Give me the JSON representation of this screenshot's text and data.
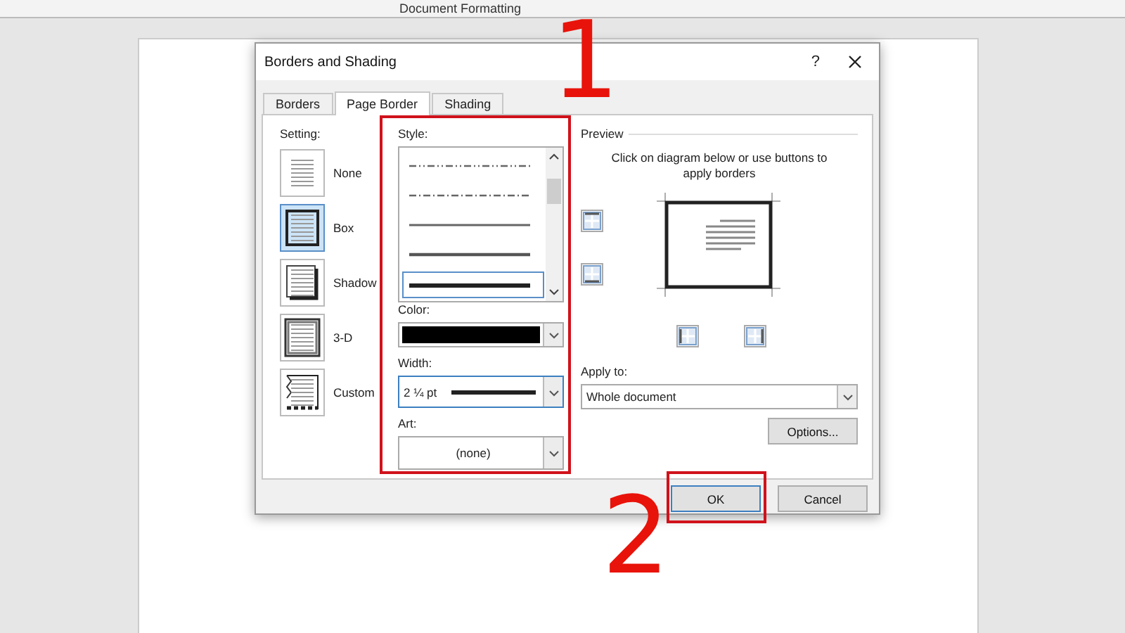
{
  "app_title": "Document Formatting",
  "dialog": {
    "title": "Borders and Shading",
    "help": "?",
    "tabs": [
      {
        "label": "Borders",
        "selected": false
      },
      {
        "label": "Page Border",
        "selected": true
      },
      {
        "label": "Shading",
        "selected": false
      }
    ],
    "setting": {
      "label": "Setting:",
      "options": [
        {
          "kind": "none",
          "label": "None",
          "selected": false
        },
        {
          "kind": "box",
          "label": "Box",
          "selected": true
        },
        {
          "kind": "shadow",
          "label": "Shadow",
          "selected": false
        },
        {
          "kind": "threed",
          "label": "3-D",
          "selected": false
        },
        {
          "kind": "custom",
          "label": "Custom",
          "selected": false
        }
      ]
    },
    "style": {
      "label": "Style:",
      "options": [
        {
          "kind": "dash-dot-dot",
          "selected": false
        },
        {
          "kind": "dash-dot",
          "selected": false
        },
        {
          "kind": "thin",
          "selected": false
        },
        {
          "kind": "medium",
          "selected": false
        },
        {
          "kind": "thick",
          "selected": true
        }
      ]
    },
    "color": {
      "label": "Color:",
      "color": "#000000"
    },
    "width": {
      "label": "Width:",
      "value": "2 ¼ pt"
    },
    "art": {
      "label": "Art:",
      "value": "(none)"
    },
    "preview": {
      "label": "Preview",
      "hint": "Click on diagram below or use buttons to apply borders"
    },
    "apply_to": {
      "label": "Apply to:",
      "value": "Whole document"
    },
    "options_button": "Options...",
    "ok_button": "OK",
    "cancel_button": "Cancel"
  },
  "annotations": [
    {
      "text": "1",
      "kind": "style"
    },
    {
      "text": "2",
      "kind": "ok"
    }
  ]
}
